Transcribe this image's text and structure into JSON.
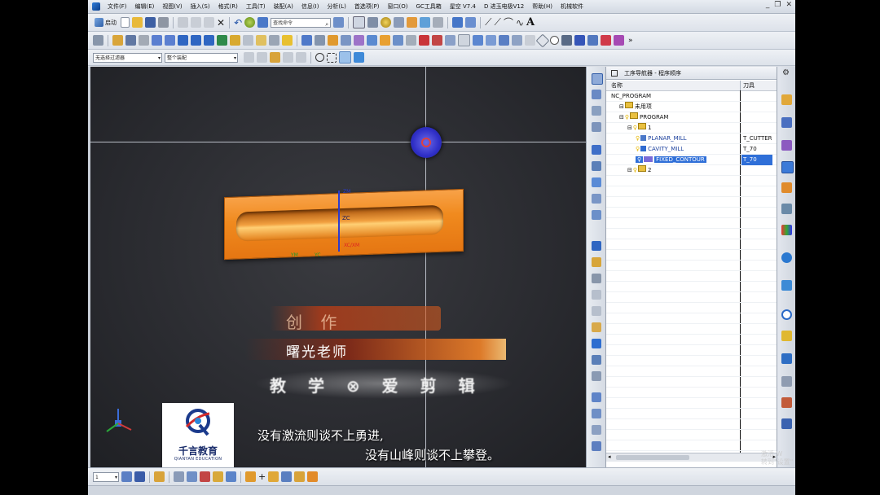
{
  "menubar": {
    "items": [
      "文件(F)",
      "编辑(E)",
      "视图(V)",
      "插入(S)",
      "格式(R)",
      "工具(T)",
      "装配(A)",
      "信息(I)",
      "分析(L)",
      "首选项(P)",
      "窗口(O)",
      "GC工具箱",
      "星空 V7.4",
      "D 进玉电极V12",
      "帮助(H)",
      "机械软件"
    ],
    "window_controls": [
      "_",
      "❐",
      "✕"
    ]
  },
  "toolbar1": {
    "start_label": "启动",
    "search_placeholder": "查找命令"
  },
  "toolbar3": {
    "selection_filter": "无选择过滤器",
    "assembly_scope": "整个装配"
  },
  "viewport": {
    "labels": {
      "zc": "ZC",
      "xc": "XC/XM",
      "ym": "YM",
      "yc": "YC",
      "zm": "ZM"
    }
  },
  "overlay": {
    "banner_line1": "创 作",
    "banner_line2": "曙光老师",
    "banner_line3": "教 学 ⊗ 爱 剪 辑",
    "logo_cn": "千言教育",
    "logo_en": "QIANYAN EDUCATION",
    "subtitle_line1": "没有激流则谈不上勇进,",
    "subtitle_line2": "没有山峰则谈不上攀登。"
  },
  "navigator": {
    "title": "工序导航器 - 程序顺序",
    "columns": {
      "name": "名称",
      "tool": "刀具"
    },
    "rows": [
      {
        "name": "NC_PROGRAM",
        "tool": "",
        "indent": 0,
        "icon": "root"
      },
      {
        "name": "未用项",
        "tool": "",
        "indent": 1,
        "icon": "folder"
      },
      {
        "name": "PROGRAM",
        "tool": "",
        "indent": 1,
        "icon": "folder"
      },
      {
        "name": "1",
        "tool": "",
        "indent": 2,
        "icon": "folder"
      },
      {
        "name": "PLANAR_MILL",
        "tool": "T_CUTTER",
        "indent": 3,
        "icon": "planar"
      },
      {
        "name": "CAVITY_MILL",
        "tool": "T_70",
        "indent": 3,
        "icon": "cavity"
      },
      {
        "name": "FIXED_CONTOUR",
        "tool": "T_70",
        "indent": 3,
        "icon": "contour",
        "selected": true
      },
      {
        "name": "2",
        "tool": "",
        "indent": 2,
        "icon": "folder"
      }
    ]
  },
  "bottombar": {
    "selector_value": "1"
  },
  "watermark": {
    "line1": "激活 W",
    "line2": "转到\"设置\""
  },
  "colors": {
    "part_orange": "#f08a1e",
    "selection_blue": "#2f6fd8",
    "viewport_bg": "#2a2b30"
  }
}
